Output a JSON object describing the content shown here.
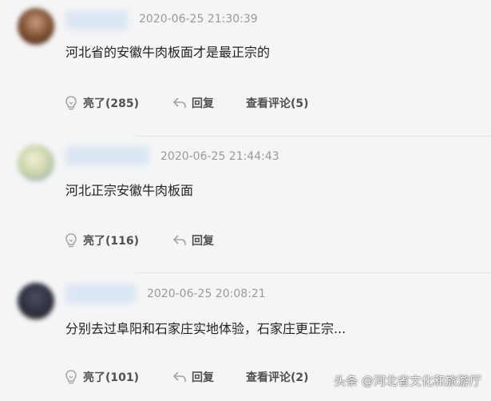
{
  "comments": [
    {
      "time": "2020-06-25 21:30:39",
      "text": "河北省的安徽牛肉板面才是最正宗的",
      "like_label": "亮了(285)",
      "reply_label": "回复",
      "view_replies_label": "查看评论(5)",
      "avatar_color": "#7a4a2e"
    },
    {
      "time": "2020-06-25 21:44:43",
      "text": "河北正宗安徽牛肉板面",
      "like_label": "亮了(116)",
      "reply_label": "回复",
      "avatar_color": "#c9d4a8"
    },
    {
      "time": "2020-06-25 20:08:21",
      "text": "分别去过阜阳和石家庄实地体验，石家庄更正宗...",
      "like_label": "亮了(101)",
      "reply_label": "回复",
      "view_replies_label": "查看评论(2)",
      "avatar_color": "#2a2d3a"
    }
  ],
  "watermark": "头条 @河北省文化和旅游厅"
}
